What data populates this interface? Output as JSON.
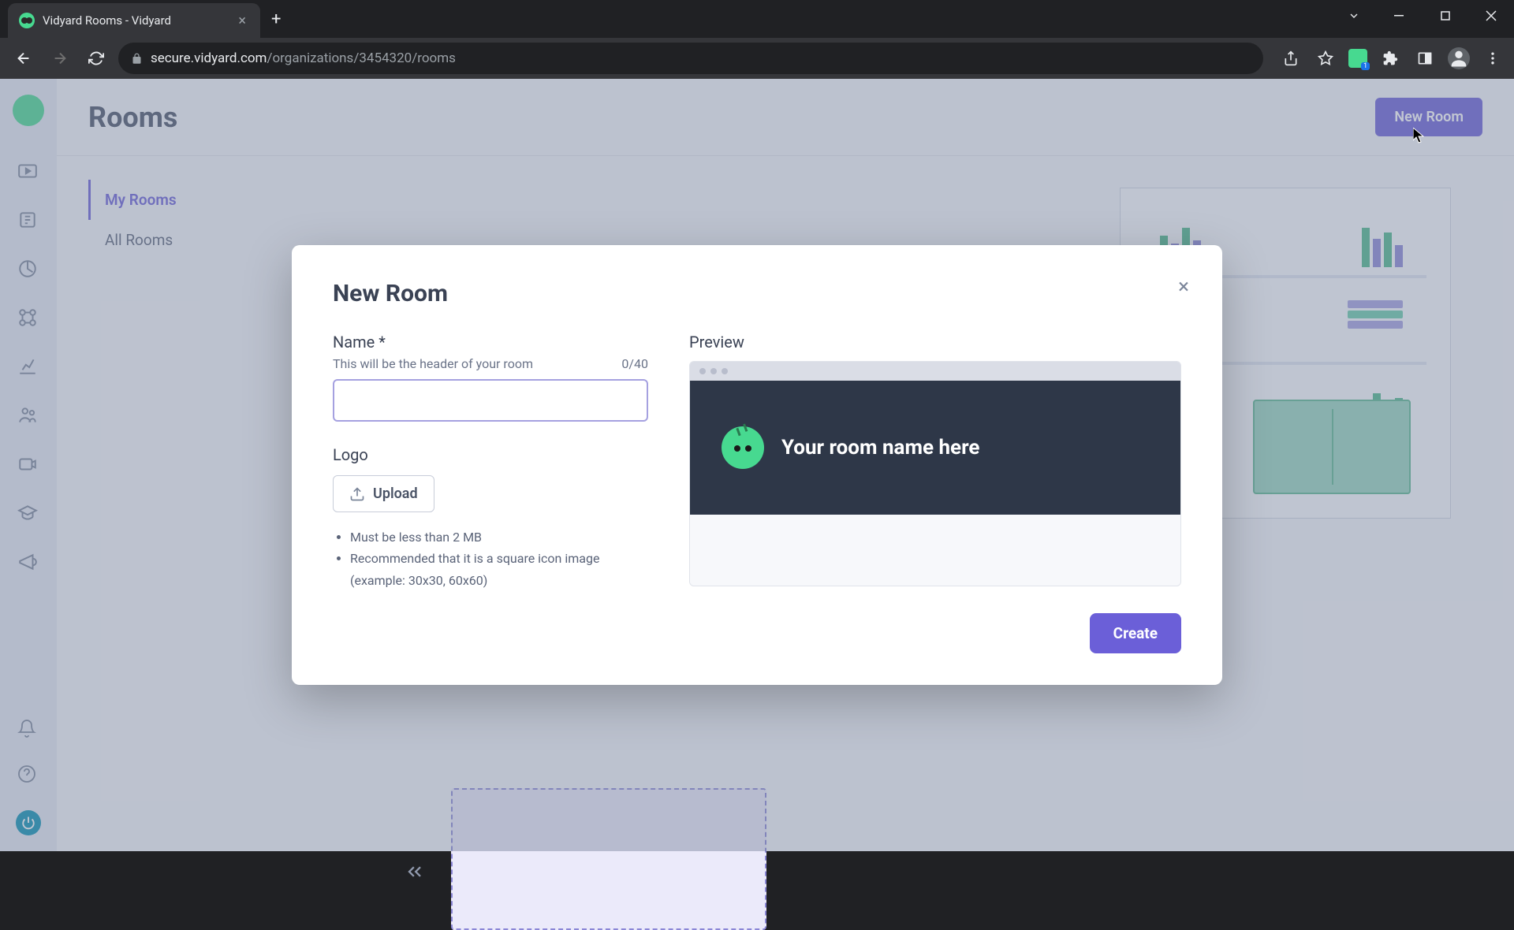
{
  "browser": {
    "tab_title": "Vidyard Rooms - Vidyard",
    "url_domain": "secure.vidyard.com",
    "url_path": "/organizations/3454320/rooms"
  },
  "page": {
    "title": "Rooms",
    "new_room_button": "New Room"
  },
  "sidebar": {
    "items": [
      {
        "label": "My Rooms"
      },
      {
        "label": "All Rooms"
      }
    ]
  },
  "modal": {
    "title": "New Room",
    "name_label": "Name *",
    "name_help": "This will be the header of your room",
    "char_count": "0/40",
    "name_value": "",
    "logo_label": "Logo",
    "upload_label": "Upload",
    "req_1": "Must be less than 2 MB",
    "req_2": "Recommended that it is a square icon image (example: 30x30, 60x60)",
    "preview_label": "Preview",
    "preview_room_name": "Your room name here",
    "create_label": "Create"
  }
}
